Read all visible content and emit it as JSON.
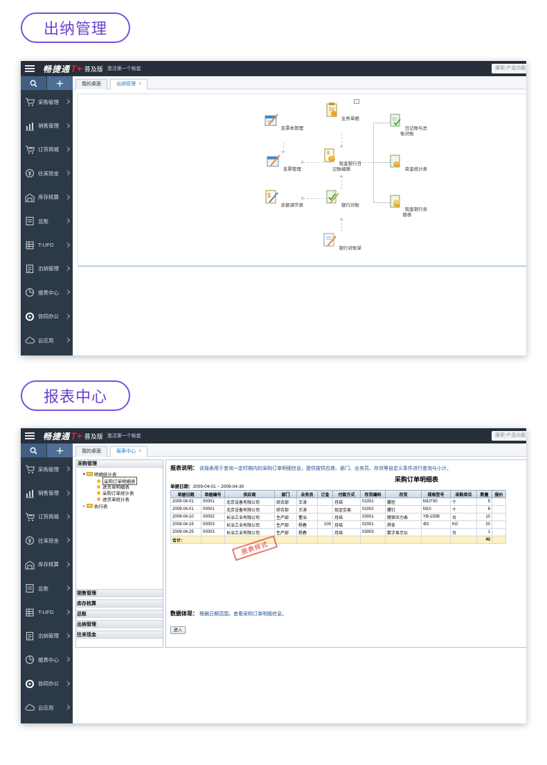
{
  "sections": [
    {
      "pill": "出纳管理"
    },
    {
      "pill": "报表中心"
    }
  ],
  "app": {
    "brand": "畅捷通",
    "brand_t": "T+",
    "edition": "普及版",
    "activate": "激活第一个帐套",
    "search_placeholder": "搜索-产品功能"
  },
  "sidebar": {
    "items": [
      {
        "label": "采购管理",
        "icon": "cart-icon"
      },
      {
        "label": "销售管理",
        "icon": "bar-chart-icon"
      },
      {
        "label": "订货商城",
        "icon": "shop-cart-icon"
      },
      {
        "label": "往来现金",
        "icon": "yen-coin-icon"
      },
      {
        "label": "库存核算",
        "icon": "warehouse-icon"
      },
      {
        "label": "总账",
        "icon": "ledger-icon"
      },
      {
        "label": "T-UFO",
        "icon": "spreadsheet-icon"
      },
      {
        "label": "出纳管理",
        "icon": "cashier-icon"
      },
      {
        "label": "报表中心",
        "icon": "pie-chart-icon"
      },
      {
        "label": "协同办公",
        "icon": "collab-icon"
      },
      {
        "label": "云应用",
        "icon": "cloud-icon"
      }
    ]
  },
  "screen1": {
    "tabs": [
      {
        "label": "我的桌面"
      },
      {
        "label": "出纳管理",
        "close": "×"
      }
    ],
    "flow": {
      "nodes": [
        {
          "id": "n1",
          "label": "支票本管理"
        },
        {
          "id": "n2",
          "label": "业务单据"
        },
        {
          "id": "n3",
          "label": "日记账与总账对账"
        },
        {
          "id": "n4",
          "label": "支票管理"
        },
        {
          "id": "n5",
          "label": "现金银行日记账编辑"
        },
        {
          "id": "n6",
          "label": "资金统计表"
        },
        {
          "id": "n7",
          "label": "余额调节表"
        },
        {
          "id": "n8",
          "label": "银行对账"
        },
        {
          "id": "n9",
          "label": "现金银行余额表"
        },
        {
          "id": "n10",
          "label": "银行对账单"
        }
      ]
    }
  },
  "screen2": {
    "tabs": [
      {
        "label": "我的桌面"
      },
      {
        "label": "报表中心",
        "close": "×"
      }
    ],
    "tree": {
      "head": "采购管理",
      "root": "明细统计表",
      "children": [
        "采购订单明细表",
        "进货单明细表",
        "采购订单统计表",
        "进货单统计表"
      ],
      "root2": "执行表",
      "categories": [
        "销售管理",
        "库存核算",
        "总账",
        "出纳管理",
        "往来现金"
      ]
    },
    "report": {
      "desc_label": "报表说明：",
      "desc_text": "该报表用于查询一定时期内的采购订单明细信息，提供按供应商、部门、业务员、存货等自定义条件进行查询与小计。",
      "title": "采购订单明细表",
      "date_label": "单据日期：",
      "date_value": "2009-04-01 ~ 2009-04-30",
      "columns": [
        "单据日期",
        "单据编号",
        "供应商",
        "部门",
        "业务员",
        "订金",
        "付款方式",
        "存货编码",
        "存货",
        "规格型号",
        "采购单位",
        "数量",
        "报价"
      ],
      "rows": [
        [
          "2009-04-01",
          "00001",
          "北京设备有限公司",
          "综合部",
          "王涛",
          "",
          "月结",
          "01001",
          "螺栓",
          "M10*30",
          "个",
          "5",
          ""
        ],
        [
          "2009-04-01",
          "00001",
          "北京设备有限公司",
          "综合部",
          "王涛",
          "",
          "现金交易",
          "01002",
          "螺钉",
          "M10",
          "个",
          "6",
          ""
        ],
        [
          "2009-04-10",
          "00002",
          "长治工业有限公司",
          "生产部",
          "董治",
          "",
          "月结",
          "03001",
          "精密压力表",
          "YB-150B",
          "台",
          "10",
          ""
        ],
        [
          "2009-04-15",
          "00003",
          "长治工业有限公司",
          "生产部",
          "杨春",
          "100",
          "月结",
          "02001",
          "焊条",
          "Φ3",
          "KG",
          "20",
          ""
        ],
        [
          "2009-04-25",
          "00003",
          "长治工业有限公司",
          "生产部",
          "杨春",
          "",
          "月结",
          "03003",
          "数字显示仪",
          "",
          "台",
          "1",
          ""
        ]
      ],
      "sum_label": "合计：",
      "sum_qty": "42",
      "stamp": "报表样式",
      "data_label": "数据体现：",
      "data_text": "根据日期范围，查看采购订单明细信息。",
      "enter_label": "进入"
    }
  },
  "colors": {
    "accent": "#6a3fd0",
    "topbar": "#262f3a",
    "sidebar": "#2c3a48",
    "tab_active": "#1d7ec9"
  }
}
